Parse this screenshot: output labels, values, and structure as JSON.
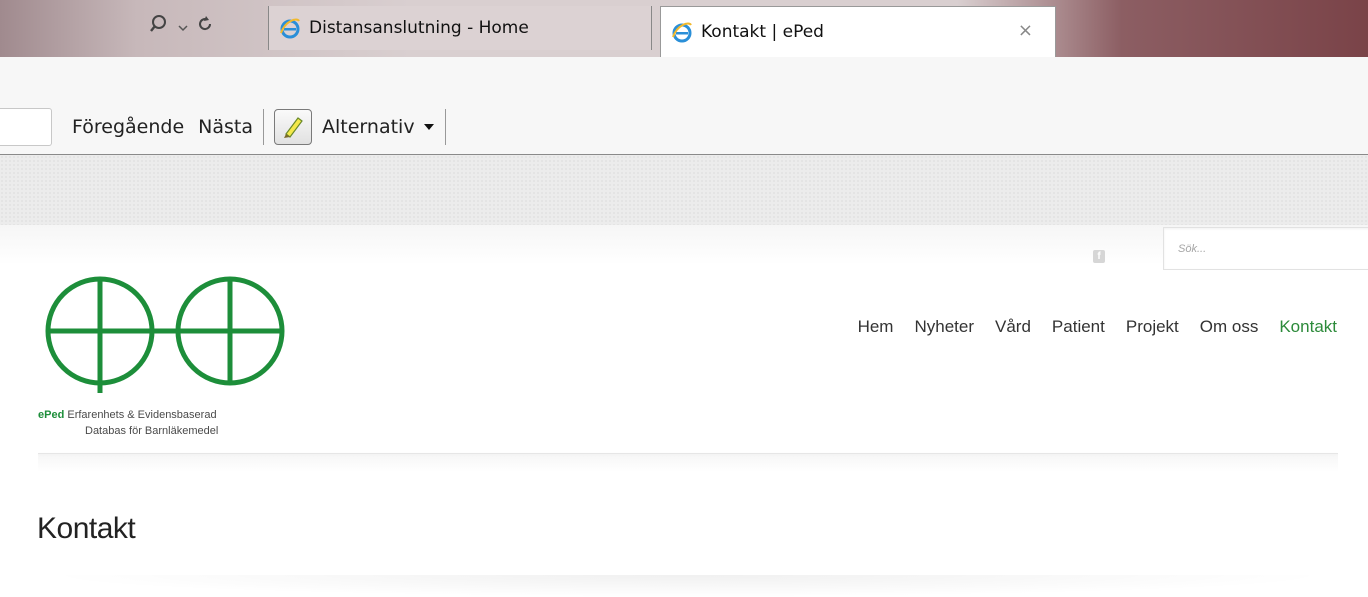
{
  "browser": {
    "tabs": [
      {
        "title": "Distansanslutning - Home",
        "active": false
      },
      {
        "title": "Kontakt | ePed",
        "active": true
      }
    ],
    "controls": {
      "search_icon": "search-icon",
      "dropdown_icon": "chevron-down-icon",
      "refresh_icon": "refresh-icon"
    },
    "tab_close": "×"
  },
  "findbar": {
    "input_value": "",
    "previous_label": "Föregående",
    "next_label": "Nästa",
    "options_label": "Alternativ",
    "highlight_icon": "highlighter-icon"
  },
  "site": {
    "search_placeholder": "Sök...",
    "social_icon": "facebook-icon",
    "facebook_glyph": "f",
    "logo_text": "ePed",
    "tagline_line1_rest": "Erfarenhets & Evidensbaserad",
    "tagline_line2": "Databas för Barnläkemedel",
    "nav": [
      "Hem",
      "Nyheter",
      "Vård",
      "Patient",
      "Projekt",
      "Om oss",
      "Kontakt"
    ],
    "active_nav": "Kontakt",
    "page_title": "Kontakt",
    "brand_color": "#1d8e3a"
  }
}
